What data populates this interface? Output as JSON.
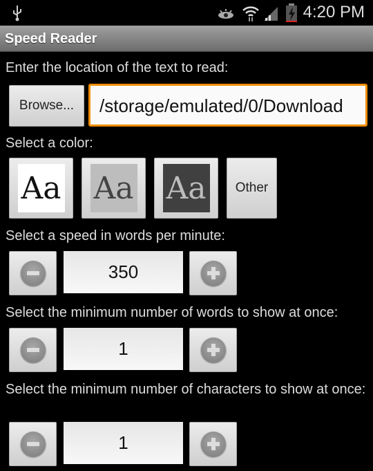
{
  "status_bar": {
    "time": "4:20 PM",
    "icons": [
      "usb-icon",
      "eye-icon",
      "wifi-icon",
      "signal-icon",
      "battery-charging-icon"
    ]
  },
  "app": {
    "title": "Speed Reader"
  },
  "location": {
    "label": "Enter the location of the text to read:",
    "browse_label": "Browse...",
    "path_value": "/storage/emulated/0/Download",
    "accent": "#f08c00"
  },
  "color": {
    "label": "Select a color:",
    "options": [
      {
        "text": "Aa",
        "bg": "#ffffff",
        "fg": "#111111"
      },
      {
        "text": "Aa",
        "bg": "#bdbdbd",
        "fg": "#444444"
      },
      {
        "text": "Aa",
        "bg": "#404040",
        "fg": "#bdbdbd"
      }
    ],
    "other_label": "Other"
  },
  "speed": {
    "label": "Select a speed in words per minute:",
    "value": "350"
  },
  "min_words": {
    "label": "Select the minimum number of words to show at once:",
    "value": "1"
  },
  "min_chars": {
    "label": "Select the minimum number of characters to show at once:",
    "value": "1"
  }
}
